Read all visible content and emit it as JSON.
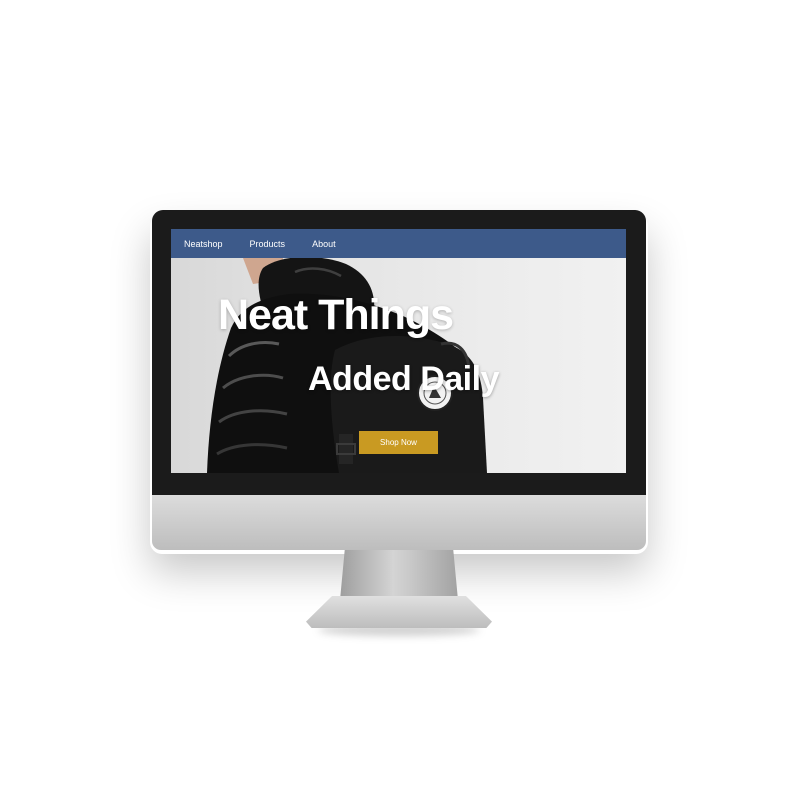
{
  "nav": {
    "brand": "Neatshop",
    "items": [
      {
        "label": "Products"
      },
      {
        "label": "About"
      }
    ]
  },
  "hero": {
    "headline_line1": "Neat Things",
    "headline_line2": "Added Daily",
    "cta_label": "Shop Now",
    "image": "person-in-black-jacket-with-backpack"
  },
  "colors": {
    "nav_background": "#3d5a8a",
    "cta_background": "#c99a22",
    "headline_text": "#ffffff"
  }
}
